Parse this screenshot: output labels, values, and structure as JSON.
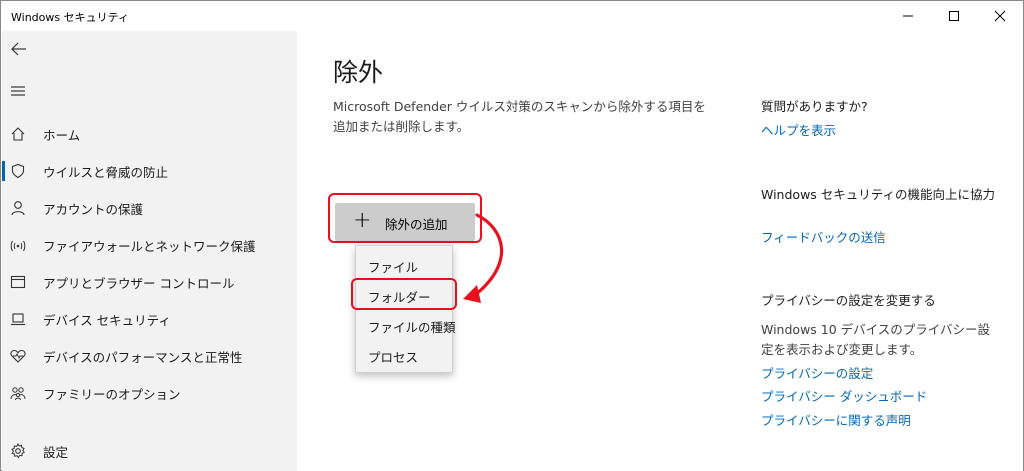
{
  "window": {
    "title": "Windows セキュリティ",
    "controls": [
      "minimize-icon",
      "maximize-icon",
      "close-icon"
    ]
  },
  "sidebar": {
    "back_icon": "back-arrow-icon",
    "menu_icon": "hamburger-menu-icon",
    "items": [
      {
        "label": "ホーム",
        "icon": "home-icon"
      },
      {
        "label": "ウイルスと脅威の防止",
        "icon": "shield-icon",
        "selected": true
      },
      {
        "label": "アカウントの保護",
        "icon": "person-icon"
      },
      {
        "label": "ファイアウォールとネットワーク保護",
        "icon": "wifi-signal-icon"
      },
      {
        "label": "アプリとブラウザー コントロール",
        "icon": "app-window-icon"
      },
      {
        "label": "デバイス セキュリティ",
        "icon": "laptop-icon"
      },
      {
        "label": "デバイスのパフォーマンスと正常性",
        "icon": "heart-pulse-icon"
      },
      {
        "label": "ファミリーのオプション",
        "icon": "family-icon"
      }
    ],
    "settings": {
      "label": "設定",
      "icon": "gear-icon"
    }
  },
  "main": {
    "title": "除外",
    "description": "Microsoft Defender ウイルス対策のスキャンから除外する項目を追加または削除します。",
    "add_button": {
      "label": "除外の追加",
      "icon": "plus-icon"
    },
    "dropdown": {
      "items": [
        "ファイル",
        "フォルダー",
        "ファイルの種類",
        "プロセス"
      ],
      "highlighted": "フォルダー"
    },
    "annotation_color": "#e8101e"
  },
  "right_panel": {
    "question": {
      "heading": "質問がありますか?",
      "link": "ヘルプを表示"
    },
    "improve": {
      "heading": "Windows セキュリティの機能向上に協力",
      "link": "フィードバックの送信"
    },
    "privacy": {
      "heading": "プライバシーの設定を変更する",
      "text": "Windows 10 デバイスのプライバシー設定を表示および変更します。",
      "links": [
        "プライバシーの設定",
        "プライバシー ダッシュボード",
        "プライバシーに関する声明"
      ]
    }
  },
  "colors": {
    "accent": "#0067b8",
    "sidebar_bg": "#f2f2f2",
    "button_bg": "#cccccc",
    "highlight": "#e8101e"
  }
}
